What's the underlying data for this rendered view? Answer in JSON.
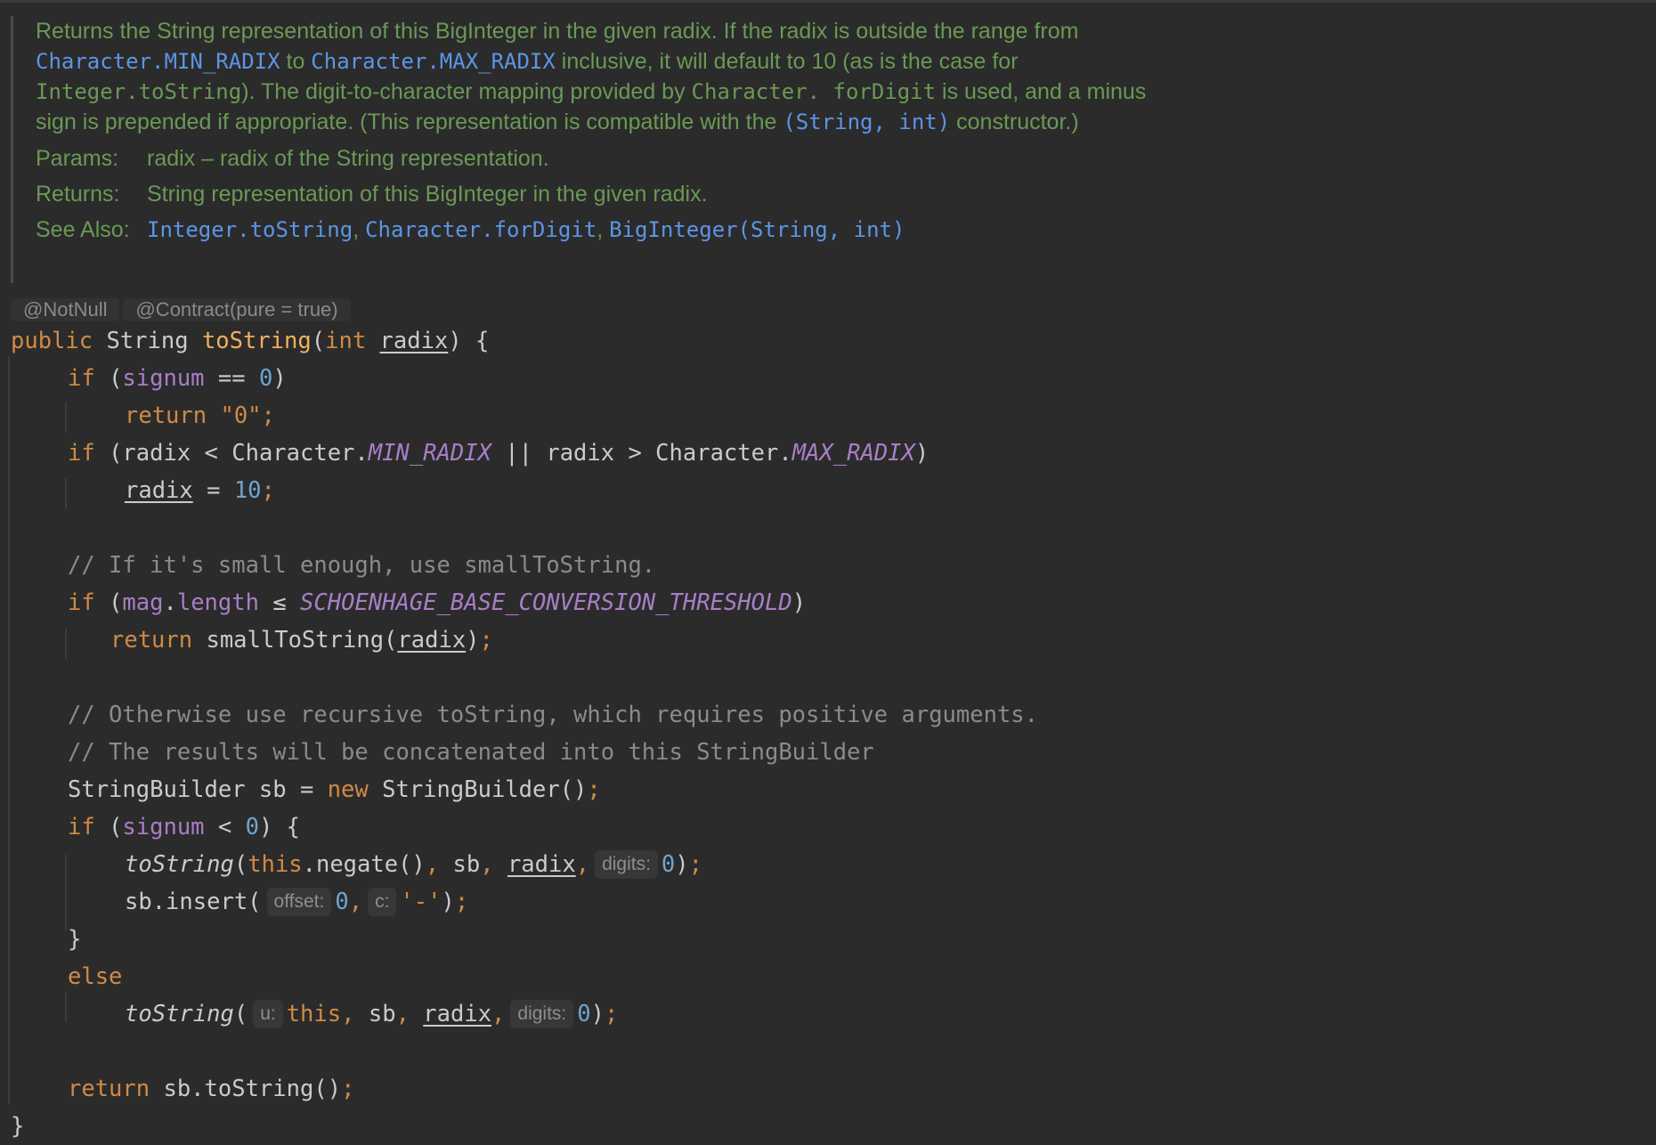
{
  "doc": {
    "p1_text1": "Returns the String representation of this BigInteger in the given radix. If the radix is outside the range from ",
    "p1_link1": "Character.MIN_RADIX",
    "p1_text2": " to ",
    "p1_link2": "Character.MAX_RADIX",
    "p1_text3": " inclusive, it will default to 10 (as is the case for ",
    "p1_mono1": "Integer.toString",
    "p1_text4": "). The digit-to-character mapping provided by ",
    "p1_mono2": "Character. forDigit",
    "p1_text5": " is used, and a minus sign is prepended if appropriate. (This representation is compatible with the ",
    "p1_link3": "(String, int)",
    "p1_text6": " constructor.)",
    "params_key": "Params:",
    "params_val": "radix – radix of the String representation.",
    "returns_key": "Returns:",
    "returns_val": "String representation of this BigInteger in the given radix.",
    "see_key": "See Also:",
    "see_link1": "Integer.toString",
    "see_sep1": ", ",
    "see_link2": "Character.forDigit",
    "see_sep2": ", ",
    "see_link3": "BigInteger(String, int)"
  },
  "annotations": [
    "@NotNull",
    "@Contract(pure = true)"
  ],
  "code": {
    "l1": {
      "a": "public ",
      "b": "String ",
      "c": "toString",
      "d": "(",
      "e": "int ",
      "f": "radix",
      "g": ") {"
    },
    "l2": {
      "a": "if ",
      "b": "(",
      "c": "signum",
      "d": " == ",
      "e": "0",
      "f": ")"
    },
    "l3": {
      "a": "return ",
      "b": "\"0\"",
      "c": ";"
    },
    "l4": {
      "a": "if ",
      "b": "(radix < Character.",
      "c": "MIN_RADIX",
      "d": " || radix > Character.",
      "e": "MAX_RADIX",
      "f": ")"
    },
    "l5": {
      "a": "radix",
      "b": " = ",
      "c": "10",
      "d": ";"
    },
    "l6": {
      "a": "// If it's small enough, use smallToString."
    },
    "l7": {
      "a": "if ",
      "b": "(",
      "c": "mag",
      "d": ".",
      "e": "length",
      "f": " ≤ ",
      "g": "SCHOENHAGE_BASE_CONVERSION_THRESHOLD",
      "h": ")"
    },
    "l8": {
      "a": "return ",
      "b": "smallToString(",
      "c": "radix",
      "d": ")",
      "e": ";"
    },
    "l9": {
      "a": "// Otherwise use recursive toString, which requires positive arguments."
    },
    "l10": {
      "a": "// The results will be concatenated into this StringBuilder"
    },
    "l11": {
      "a": "StringBuilder sb = ",
      "b": "new ",
      "c": "StringBuilder()",
      "d": ";"
    },
    "l12": {
      "a": "if ",
      "b": "(",
      "c": "signum",
      "d": " < ",
      "e": "0",
      "f": ") {"
    },
    "l13": {
      "a": "toString",
      "b": "(",
      "c": "this",
      "d": ".negate()",
      "e": ", ",
      "f": "sb",
      "g": ", ",
      "h": "radix",
      "i": ",",
      "hint": "digits:",
      "j": "0",
      "k": ")",
      "l": ";"
    },
    "l14": {
      "a": "sb.insert(",
      "hint1": "offset:",
      "b": "0",
      "c": ",",
      "hint2": "c:",
      "d": "'-'",
      "e": ")",
      "f": ";"
    },
    "l15": {
      "a": "}"
    },
    "l16": {
      "a": "else"
    },
    "l17": {
      "a": "toString",
      "b": "(",
      "hint1": "u:",
      "c": "this",
      "d": ", ",
      "e": "sb",
      "f": ", ",
      "g": "radix",
      "h": ",",
      "hint2": "digits:",
      "i": "0",
      "j": ")",
      "k": ";"
    },
    "l18": {
      "a": "return ",
      "b": "sb.toString()",
      "c": ";"
    },
    "l19": {
      "a": "}"
    }
  }
}
